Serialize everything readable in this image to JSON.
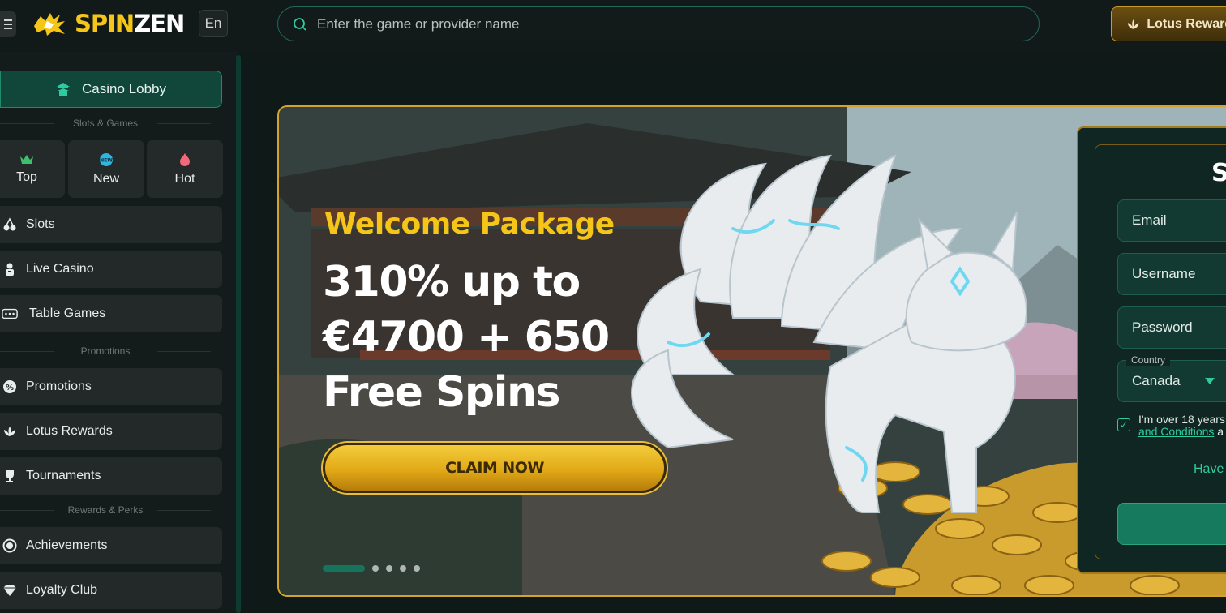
{
  "header": {
    "logo_spin": "SPIN",
    "logo_zen": "ZEN",
    "language": "En",
    "search_placeholder": "Enter the game or provider name",
    "lotus_rewards_button": "Lotus Rewards"
  },
  "sidebar": {
    "lobby_label": "Casino Lobby",
    "section_slots_games": "Slots & Games",
    "tiles": [
      {
        "label": "Top",
        "icon": "crown-icon"
      },
      {
        "label": "New",
        "icon": "new-badge-icon"
      },
      {
        "label": "Hot",
        "icon": "flame-icon"
      }
    ],
    "games": [
      {
        "label": "Slots",
        "icon": "cherries-icon"
      },
      {
        "label": "Live Casino",
        "icon": "dealer-icon"
      },
      {
        "label": "Table Games",
        "icon": "table-icon"
      }
    ],
    "section_promotions": "Promotions",
    "promos": [
      {
        "label": "Promotions",
        "icon": "percent-icon"
      },
      {
        "label": "Lotus Rewards",
        "icon": "lotus-icon"
      },
      {
        "label": "Tournaments",
        "icon": "trophy-icon"
      }
    ],
    "section_rewards": "Rewards & Perks",
    "rewards": [
      {
        "label": "Achievements",
        "icon": "medal-icon"
      },
      {
        "label": "Loyalty Club",
        "icon": "diamond-icon"
      }
    ]
  },
  "banner": {
    "welcome": "Welcome Package",
    "headline_line1": "310% up to",
    "headline_line2": "€4700 + 650",
    "headline_line3": "Free Spins",
    "cta": "CLAIM NOW",
    "slides_total": 5,
    "active_slide": 1
  },
  "signup": {
    "title_partial": "S",
    "email_placeholder": "Email",
    "username_placeholder": "Username",
    "password_placeholder": "Password",
    "country_label": "Country",
    "country_value": "Canada",
    "consent_line1": "I'm over 18 years",
    "consent_link": "and Conditions",
    "consent_after": " a",
    "have_account_partial": "Have"
  },
  "colors": {
    "accent_green": "#1d8b6c",
    "gold": "#f5c518",
    "background": "#0f1a18"
  }
}
